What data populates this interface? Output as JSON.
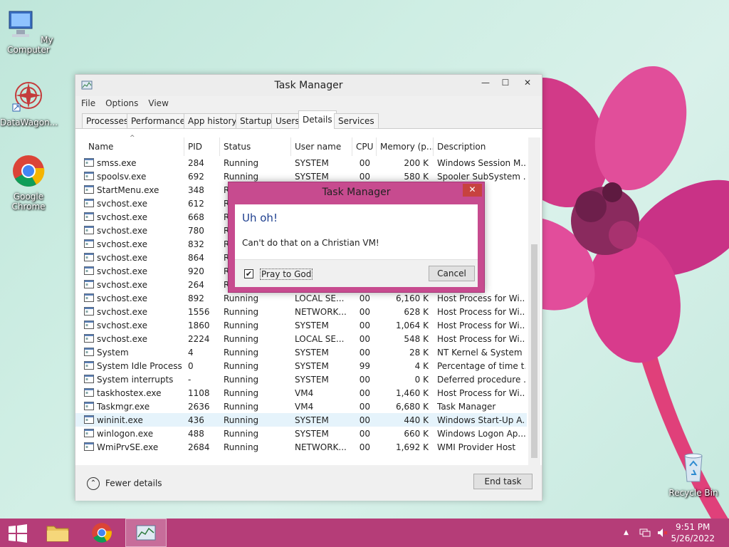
{
  "desktop": {
    "icons": [
      {
        "label": "My Computer"
      },
      {
        "label": "DataWagon..."
      },
      {
        "label": "Google Chrome"
      },
      {
        "label": "Recycle Bin"
      }
    ]
  },
  "window": {
    "title": "Task Manager",
    "controls": {
      "minimize": "—",
      "maximize": "☐",
      "close": "✕"
    },
    "menu": [
      "File",
      "Options",
      "View"
    ],
    "tabs": [
      "Processes",
      "Performance",
      "App history",
      "Startup",
      "Users",
      "Details",
      "Services"
    ],
    "active_tab": "Details",
    "columns": [
      "Name",
      "PID",
      "Status",
      "User name",
      "CPU",
      "Memory (p...",
      "Description"
    ],
    "rows": [
      {
        "name": "smss.exe",
        "pid": "284",
        "status": "Running",
        "user": "SYSTEM",
        "cpu": "00",
        "mem": "200 K",
        "desc": "Windows Session M..."
      },
      {
        "name": "spoolsv.exe",
        "pid": "692",
        "status": "Running",
        "user": "SYSTEM",
        "cpu": "00",
        "mem": "580 K",
        "desc": "Spooler SubSystem ..."
      },
      {
        "name": "StartMenu.exe",
        "pid": "348",
        "status": "R",
        "user": "",
        "cpu": "",
        "mem": "",
        "desc": "enu"
      },
      {
        "name": "svchost.exe",
        "pid": "612",
        "status": "R",
        "user": "",
        "cpu": "",
        "mem": "",
        "desc": "for Wi..."
      },
      {
        "name": "svchost.exe",
        "pid": "668",
        "status": "R",
        "user": "",
        "cpu": "",
        "mem": "",
        "desc": "for Wi..."
      },
      {
        "name": "svchost.exe",
        "pid": "780",
        "status": "R",
        "user": "",
        "cpu": "",
        "mem": "",
        "desc": "for Wi..."
      },
      {
        "name": "svchost.exe",
        "pid": "832",
        "status": "R",
        "user": "",
        "cpu": "",
        "mem": "",
        "desc": "for Wi..."
      },
      {
        "name": "svchost.exe",
        "pid": "864",
        "status": "R",
        "user": "",
        "cpu": "",
        "mem": "",
        "desc": "for Wi..."
      },
      {
        "name": "svchost.exe",
        "pid": "920",
        "status": "R",
        "user": "",
        "cpu": "",
        "mem": "",
        "desc": "for Wi..."
      },
      {
        "name": "svchost.exe",
        "pid": "264",
        "status": "R",
        "user": "",
        "cpu": "",
        "mem": "",
        "desc": "for Wi..."
      },
      {
        "name": "svchost.exe",
        "pid": "892",
        "status": "Running",
        "user": "LOCAL SE...",
        "cpu": "00",
        "mem": "6,160 K",
        "desc": "Host Process for Wi..."
      },
      {
        "name": "svchost.exe",
        "pid": "1556",
        "status": "Running",
        "user": "NETWORK...",
        "cpu": "00",
        "mem": "628 K",
        "desc": "Host Process for Wi..."
      },
      {
        "name": "svchost.exe",
        "pid": "1860",
        "status": "Running",
        "user": "SYSTEM",
        "cpu": "00",
        "mem": "1,064 K",
        "desc": "Host Process for Wi..."
      },
      {
        "name": "svchost.exe",
        "pid": "2224",
        "status": "Running",
        "user": "LOCAL SE...",
        "cpu": "00",
        "mem": "548 K",
        "desc": "Host Process for Wi..."
      },
      {
        "name": "System",
        "pid": "4",
        "status": "Running",
        "user": "SYSTEM",
        "cpu": "00",
        "mem": "28 K",
        "desc": "NT Kernel & System"
      },
      {
        "name": "System Idle Process",
        "pid": "0",
        "status": "Running",
        "user": "SYSTEM",
        "cpu": "99",
        "mem": "4 K",
        "desc": "Percentage of time t..."
      },
      {
        "name": "System interrupts",
        "pid": "-",
        "status": "Running",
        "user": "SYSTEM",
        "cpu": "00",
        "mem": "0 K",
        "desc": "Deferred procedure ..."
      },
      {
        "name": "taskhostex.exe",
        "pid": "1108",
        "status": "Running",
        "user": "VM4",
        "cpu": "00",
        "mem": "1,460 K",
        "desc": "Host Process for Wi..."
      },
      {
        "name": "Taskmgr.exe",
        "pid": "2636",
        "status": "Running",
        "user": "VM4",
        "cpu": "00",
        "mem": "6,680 K",
        "desc": "Task Manager"
      },
      {
        "name": "wininit.exe",
        "pid": "436",
        "status": "Running",
        "user": "SYSTEM",
        "cpu": "00",
        "mem": "440 K",
        "desc": "Windows Start-Up A..."
      },
      {
        "name": "winlogon.exe",
        "pid": "488",
        "status": "Running",
        "user": "SYSTEM",
        "cpu": "00",
        "mem": "660 K",
        "desc": "Windows Logon Ap..."
      },
      {
        "name": "WmiPrvSE.exe",
        "pid": "2684",
        "status": "Running",
        "user": "NETWORK...",
        "cpu": "00",
        "mem": "1,692 K",
        "desc": "WMI Provider Host"
      }
    ],
    "selected_row": "wininit.exe",
    "fewer_details": "Fewer details",
    "end_task": "End task"
  },
  "dialog": {
    "title": "Task Manager",
    "close": "✕",
    "heading": "Uh oh!",
    "message": "Can't do that on a Christian VM!",
    "checkbox_label": "Pray to God",
    "checkbox_checked": true,
    "checkbox_mark": "✔",
    "cancel": "Cancel"
  },
  "taskbar": {
    "time": "9:51 PM",
    "date": "5/26/2022",
    "tray_arrow": "▲"
  },
  "colors": {
    "taskbar": "#b53d78",
    "dialog_frame": "#c74b8f",
    "heading": "#1e3f8f",
    "selection": "#e5f3fb"
  }
}
